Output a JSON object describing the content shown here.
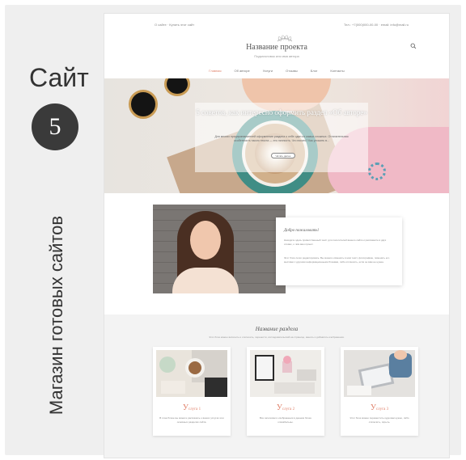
{
  "side": {
    "title": "Сайт",
    "number": "5",
    "vertical_label": "Магазин готовых сайтов"
  },
  "site": {
    "topbar_left": "О сайте · Купить этот сайт",
    "topbar_right": "Тел.: +7(000)000-00-00 · email: info@mail.ru",
    "name": "Название проекта",
    "subtitle": "Подзаголовок или имя автора",
    "nav": [
      "Главная",
      "Об авторе",
      "Услуги",
      "Отзывы",
      "Блог",
      "Контакты"
    ],
    "hero": {
      "title": "5 советов, как интересно оформить раздел «Об авторе»",
      "text": "Для многих предпринимателей оформление раздела о себе один из самых сложных. Отличительная особенность такого текста — это личность. Что писать? Как уложить в...",
      "button": "Читать далее"
    },
    "about": {
      "title": "Добро пожаловать!",
      "p1": "Находите здесь приветственный текст для посетителей вашего сайта и расскажите в двух словах, о чём ваш проект.",
      "p2": "Этот блок легко редактировать. Вы можете изменить в нём текст, фотографию, поменять его местами с другими информационными блоками, либо отключить, если он вам не нужен."
    },
    "section": {
      "title": "Название раздела",
      "subtitle": "Этот блок можно включить и отключить, перенести, исследовательский на странице, менять и добавлять изображения.",
      "services": [
        {
          "title_cap": "У",
          "title_rest": "слуга 1",
          "desc": "В этом блоке вы можете рассказать о ваших услугах или основных разделах сайта."
        },
        {
          "title_cap": "У",
          "title_rest": "слуга 2",
          "desc": "Все заголовки и изображения в данном блоке кликабельны."
        },
        {
          "title_cap": "У",
          "title_rest": "слуга 3",
          "desc": "Этот блок можно переместить куда вам нужно, либо отключить, скрыть."
        }
      ]
    }
  },
  "colors": {
    "accent": "#e0826b",
    "badge": "#3a3a3a",
    "frame": "#efefef"
  }
}
